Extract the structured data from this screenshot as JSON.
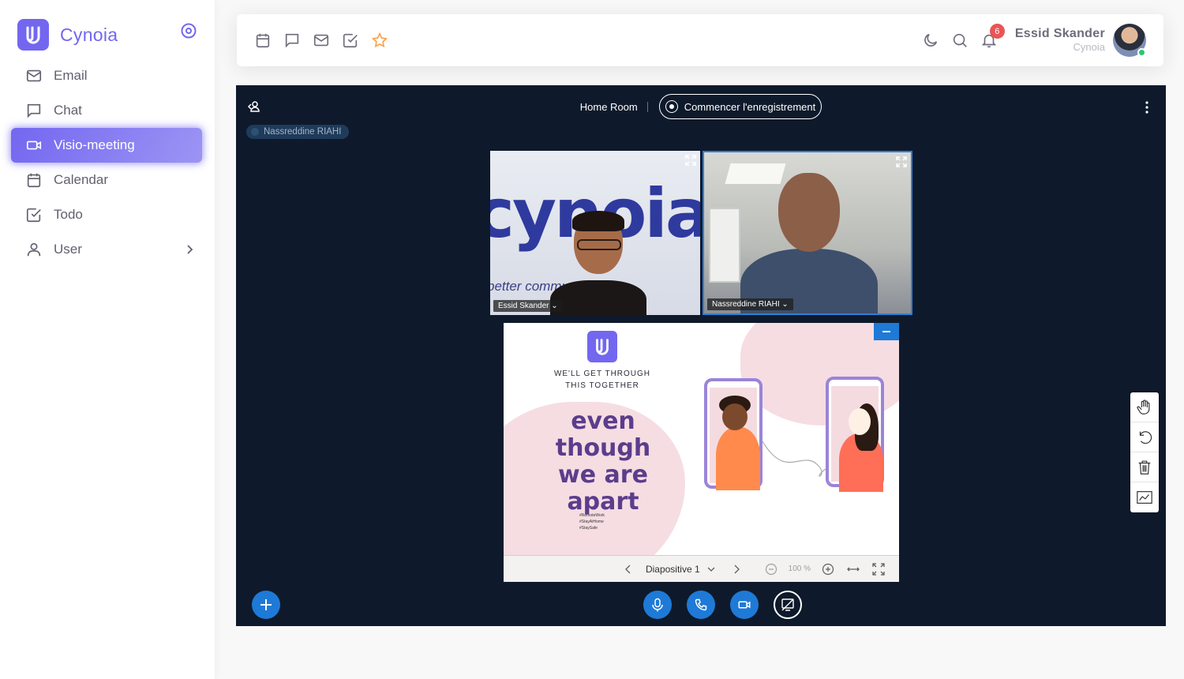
{
  "brand": {
    "name": "Cynoia"
  },
  "sidebar": {
    "items": [
      {
        "label": "Email",
        "icon": "mail-icon",
        "active": false
      },
      {
        "label": "Chat",
        "icon": "message-square-icon",
        "active": false
      },
      {
        "label": "Visio-meeting",
        "icon": "video-icon",
        "active": true
      },
      {
        "label": "Calendar",
        "icon": "calendar-icon",
        "active": false
      },
      {
        "label": "Todo",
        "icon": "check-square-icon",
        "active": false
      },
      {
        "label": "User",
        "icon": "user-icon",
        "active": false
      }
    ]
  },
  "navbar": {
    "notification_count": "6",
    "user": {
      "name": "Essid Skander",
      "status": "Cynoia"
    }
  },
  "meeting": {
    "room_name": "Home Room",
    "record_label": "Commencer l'enregistrement",
    "active_speaker": "Nassreddine RIAHI",
    "participants": [
      {
        "name": "Essid Skander"
      },
      {
        "name": "Nassreddine RIAHI"
      }
    ],
    "webcam_backdrop": {
      "logo": "cynoia",
      "tagline": "better commun"
    },
    "slide": {
      "subtitle_line1": "WE'LL GET THROUGH",
      "subtitle_line2": "THIS TOGETHER",
      "title_line1": "even though",
      "title_line2": "we are apart",
      "hashtags": [
        "#RemoteWork",
        "#StayAtHome",
        "#StaySafe"
      ],
      "current_slide_label": "Diapositive 1",
      "zoom": "100 %"
    }
  },
  "colors": {
    "primary": "#7367f0",
    "meeting_bg": "#0e1a2b",
    "control_blue": "#1e7ad6",
    "badge_red": "#ea5455",
    "online_green": "#28c76f"
  }
}
